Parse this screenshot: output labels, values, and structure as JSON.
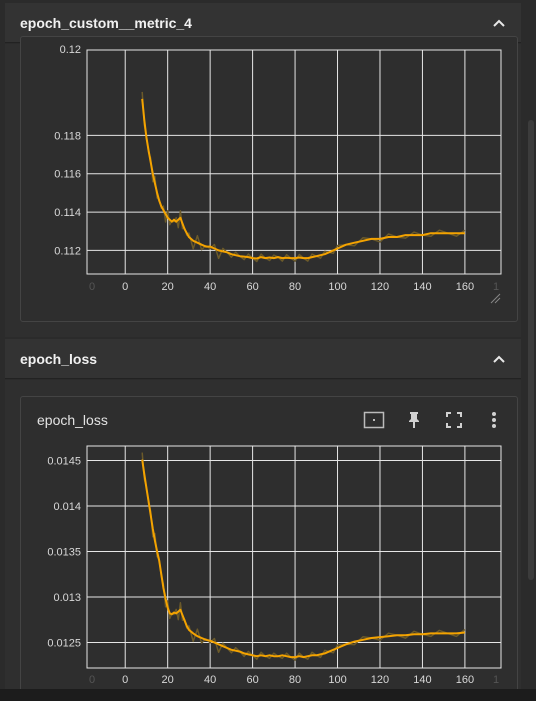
{
  "sections": [
    {
      "title": "epoch_custom__metric_4",
      "collapsed": false
    },
    {
      "title": "epoch_loss",
      "collapsed": false
    }
  ],
  "card2": {
    "title": "epoch_loss",
    "tools": [
      "fit-domain-icon",
      "pin-icon",
      "fullscreen-icon",
      "more-vert-icon"
    ]
  },
  "colors": {
    "smoothed": "#f4a300",
    "raw": "#6b5a2a",
    "grid": "#e6e6e6",
    "background": "#2b2b2b"
  },
  "chart_data": [
    {
      "type": "line",
      "title": "",
      "xlabel": "",
      "ylabel": "",
      "xlim": [
        -18,
        177
      ],
      "ylim": [
        0.11077,
        0.12193
      ],
      "x_ticks": [
        0,
        20,
        40,
        60,
        80,
        100,
        120,
        140,
        160
      ],
      "x_ticks_faint": [
        "0",
        "1"
      ],
      "y_ticks": [
        0.112,
        0.114,
        0.116,
        0.118
      ],
      "y_tick_labels": [
        "0.112",
        "0.114",
        "0.116",
        "0.118"
      ],
      "y_top_partial_label": "0.12",
      "series": [
        {
          "x": [
            8,
            9,
            10,
            11,
            12,
            13,
            14,
            15,
            16,
            17,
            18,
            19,
            20,
            21,
            22,
            23,
            24,
            25,
            26,
            27,
            28,
            29,
            30,
            32,
            34,
            36,
            38,
            40,
            42,
            44,
            46,
            48,
            50,
            52,
            54,
            56,
            58,
            60,
            62,
            64,
            66,
            68,
            70,
            72,
            74,
            76,
            78,
            80,
            82,
            84,
            86,
            88,
            90,
            92,
            94,
            96,
            98,
            100,
            104,
            108,
            112,
            116,
            120,
            124,
            128,
            132,
            136,
            140,
            144,
            148,
            152,
            156,
            160
          ],
          "values": [
            0.1199,
            0.1188,
            0.1179,
            0.1172,
            0.1166,
            0.116,
            0.1155,
            0.115,
            0.1146,
            0.1143,
            0.1141,
            0.1139,
            0.1137,
            0.1136,
            0.1135,
            0.1136,
            0.1135,
            0.1136,
            0.1137,
            0.1134,
            0.1131,
            0.1129,
            0.1127,
            0.1125,
            0.1124,
            0.1123,
            0.1122,
            0.1122,
            0.1121,
            0.112,
            0.11195,
            0.1119,
            0.1118,
            0.11175,
            0.1117,
            0.11168,
            0.11165,
            0.1116,
            0.11158,
            0.11165,
            0.1116,
            0.11163,
            0.1116,
            0.11165,
            0.1116,
            0.11162,
            0.1116,
            0.1116,
            0.11163,
            0.1116,
            0.1116,
            0.11165,
            0.1117,
            0.11175,
            0.1118,
            0.1119,
            0.112,
            0.1121,
            0.1123,
            0.1124,
            0.1125,
            0.1126,
            0.1126,
            0.1127,
            0.1127,
            0.1128,
            0.1128,
            0.1128,
            0.1129,
            0.1129,
            0.1129,
            0.1129,
            0.1129
          ]
        }
      ]
    },
    {
      "type": "line",
      "title": "",
      "xlabel": "",
      "ylabel": "",
      "xlim": [
        -18,
        177
      ],
      "ylim": [
        0.01222,
        0.01455
      ],
      "x_ticks": [
        0,
        20,
        40,
        60,
        80,
        100,
        120,
        140,
        160
      ],
      "x_ticks_faint": [
        "0",
        "1"
      ],
      "y_ticks": [
        0.0125,
        0.013,
        0.0135,
        0.014,
        0.0145
      ],
      "y_tick_labels": [
        "0.0125",
        "0.013",
        "0.0135",
        "0.014",
        "0.0145"
      ],
      "series": [
        {
          "x": [
            8,
            9,
            10,
            11,
            12,
            13,
            14,
            15,
            16,
            17,
            18,
            19,
            20,
            21,
            22,
            23,
            24,
            25,
            26,
            27,
            28,
            29,
            30,
            32,
            34,
            36,
            38,
            40,
            42,
            44,
            46,
            48,
            50,
            52,
            54,
            56,
            58,
            60,
            62,
            64,
            66,
            68,
            70,
            72,
            74,
            76,
            78,
            80,
            82,
            84,
            86,
            88,
            90,
            92,
            94,
            96,
            98,
            100,
            104,
            108,
            112,
            116,
            120,
            124,
            128,
            132,
            136,
            140,
            144,
            148,
            152,
            156,
            160
          ],
          "values": [
            0.01451,
            0.01435,
            0.0142,
            0.01405,
            0.0139,
            0.01375,
            0.01362,
            0.0135,
            0.0134,
            0.01325,
            0.0131,
            0.01298,
            0.01288,
            0.01282,
            0.01281,
            0.01283,
            0.01282,
            0.01284,
            0.01286,
            0.0128,
            0.01274,
            0.01268,
            0.01264,
            0.0126,
            0.01257,
            0.01255,
            0.01253,
            0.01252,
            0.0125,
            0.01248,
            0.01246,
            0.01244,
            0.01242,
            0.01241,
            0.0124,
            0.01238,
            0.01237,
            0.01236,
            0.01235,
            0.01236,
            0.01235,
            0.01236,
            0.01235,
            0.01235,
            0.01236,
            0.01235,
            0.01234,
            0.01234,
            0.01235,
            0.01234,
            0.01235,
            0.01236,
            0.01236,
            0.01237,
            0.01238,
            0.0124,
            0.01242,
            0.01244,
            0.01248,
            0.01251,
            0.01253,
            0.01255,
            0.01256,
            0.01257,
            0.01258,
            0.01258,
            0.01259,
            0.01259,
            0.0126,
            0.0126,
            0.0126,
            0.0126,
            0.01261
          ]
        }
      ]
    }
  ]
}
